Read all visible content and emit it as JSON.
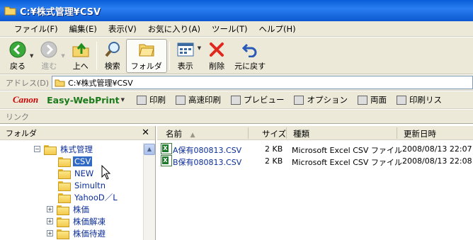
{
  "window": {
    "title": "C:¥株式管理¥CSV"
  },
  "menu": [
    "ファイル(F)",
    "編集(E)",
    "表示(V)",
    "お気に入り(A)",
    "ツール(T)",
    "ヘルプ(H)"
  ],
  "toolbar": {
    "back": "戻る",
    "forward": "進む",
    "up": "上へ",
    "search": "検索",
    "folders": "フォルダ",
    "views": "表示",
    "delete": "削除",
    "undo": "元に戻す"
  },
  "address": {
    "label": "アドレス(D)",
    "value": "C:¥株式管理¥CSV"
  },
  "canon_bar": {
    "brand": "Canon",
    "product": "Easy-WebPrint",
    "print": "印刷",
    "hq_print": "高速印刷",
    "preview": "プレビュー",
    "options": "オプション",
    "duplex": "両面",
    "print_list": "印刷リス"
  },
  "links_label": "リンク",
  "folder_pane": {
    "title": "フォルダ",
    "tree": [
      {
        "label": "株式管理",
        "expander": "−",
        "level": 0
      },
      {
        "label": "CSV",
        "expander": "",
        "level": 1,
        "selected": true
      },
      {
        "label": "NEW",
        "expander": "",
        "level": 1
      },
      {
        "label": "Simultn",
        "expander": "",
        "level": 1
      },
      {
        "label": "YahooD／L",
        "expander": "",
        "level": 1
      },
      {
        "label": "株価",
        "expander": "+",
        "level": 1
      },
      {
        "label": "株価解凍",
        "expander": "+",
        "level": 1
      },
      {
        "label": "株価待避",
        "expander": "+",
        "level": 1
      }
    ]
  },
  "file_list": {
    "columns": {
      "name": "名前",
      "size": "サイズ",
      "type": "種類",
      "modified": "更新日時"
    },
    "rows": [
      {
        "name": "A保有080813.CSV",
        "size": "2 KB",
        "type": "Microsoft Excel CSV ファイル",
        "modified": "2008/08/13 22:07"
      },
      {
        "name": "B保有080813.CSV",
        "size": "2 KB",
        "type": "Microsoft Excel CSV ファイル",
        "modified": "2008/08/13 22:08"
      }
    ]
  },
  "colors": {
    "title_bar": "#0a5fd8",
    "selection": "#316ac5",
    "chrome": "#ece9d8",
    "link_text": "#0b2d9a"
  }
}
